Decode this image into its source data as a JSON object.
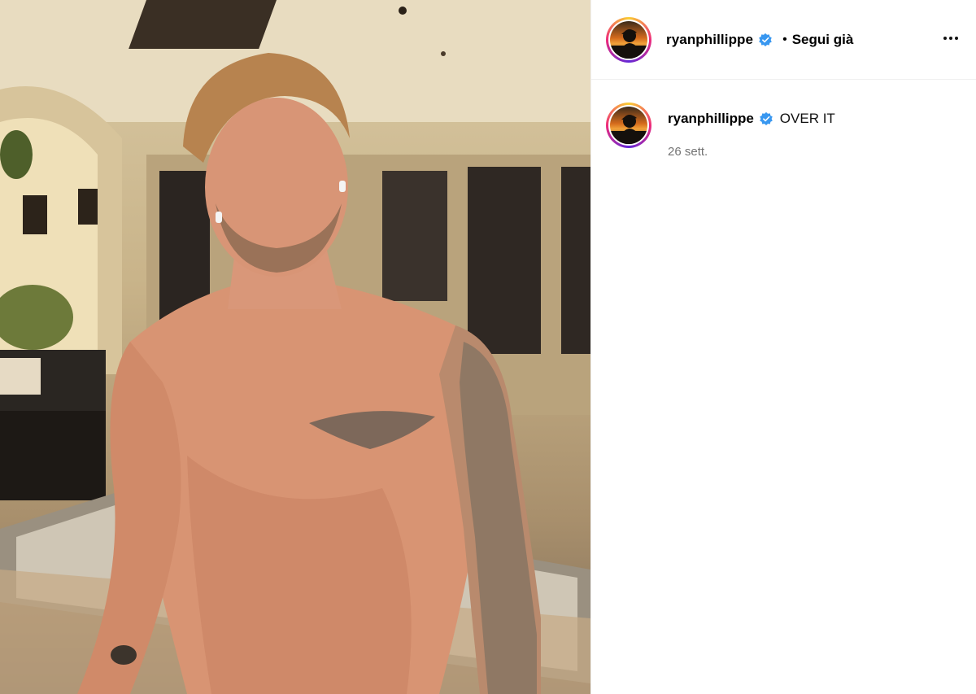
{
  "post": {
    "author": {
      "username": "ryanphillippe",
      "verified": true,
      "follow_state": "Segui già",
      "separator": "•"
    },
    "caption": {
      "username": "ryanphillippe",
      "text": "OVER IT",
      "timestamp": "26 sett."
    },
    "media": {
      "type": "photo"
    }
  },
  "colors": {
    "verified_badge": "#3897f0",
    "border": "#efefef",
    "muted_text": "#737373"
  },
  "icons": {
    "more": "more-options-icon",
    "verified": "verified-badge-icon"
  }
}
